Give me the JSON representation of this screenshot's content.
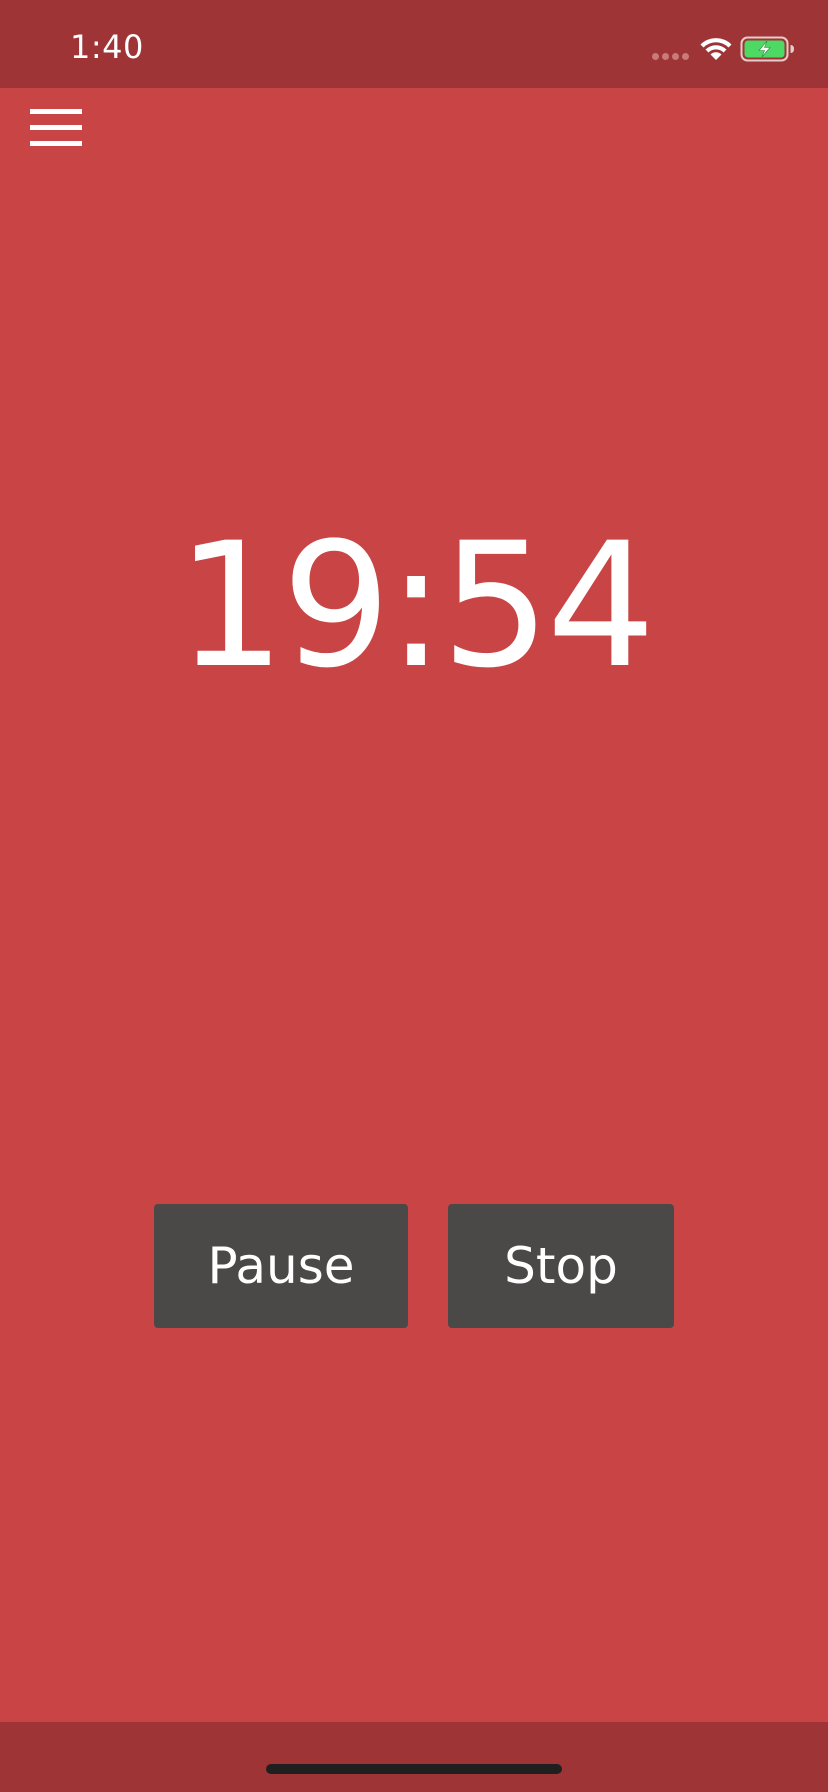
{
  "status_bar": {
    "time": "1:40",
    "wifi_icon": "wifi-icon",
    "battery_icon": "battery-charging-icon",
    "battery_color": "#4cd964"
  },
  "header": {
    "menu_icon": "hamburger-menu-icon"
  },
  "timer": {
    "display": "19:54"
  },
  "controls": {
    "pause_label": "Pause",
    "stop_label": "Stop"
  },
  "colors": {
    "background": "#c94444",
    "bars": "#9e3436",
    "button": "#4b4848",
    "text": "#ffffff"
  }
}
